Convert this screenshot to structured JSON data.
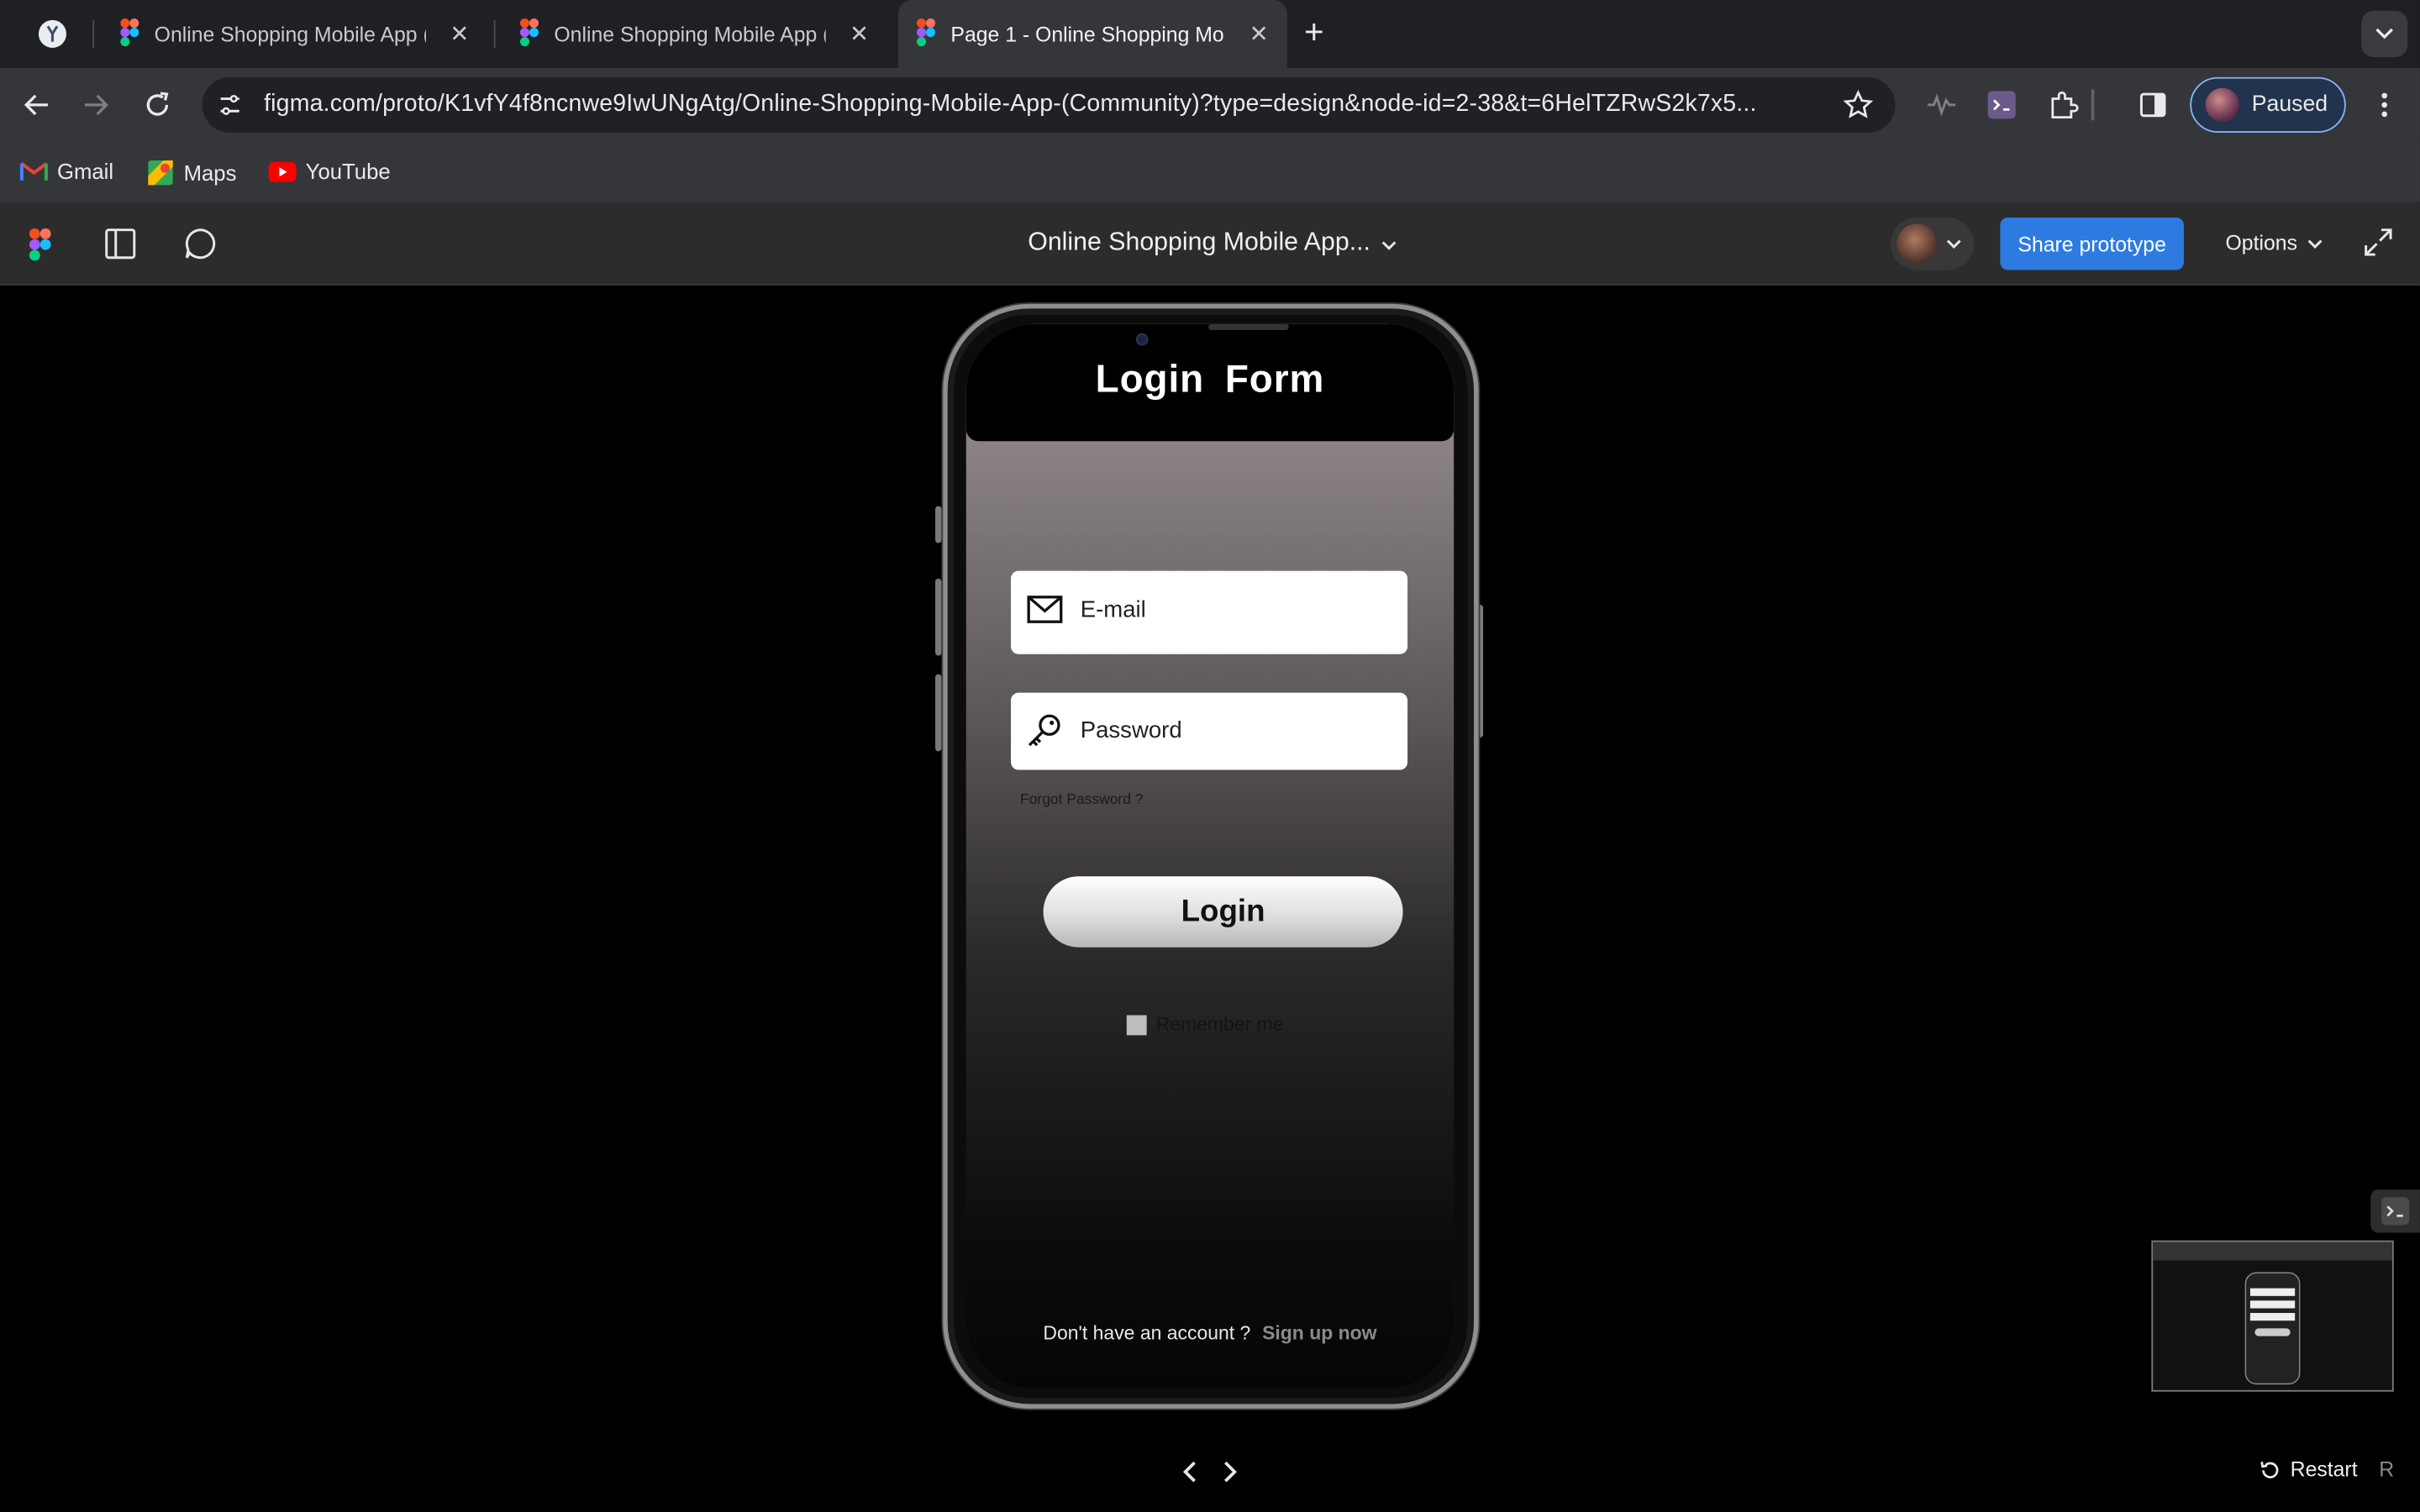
{
  "browser": {
    "tabs": [
      {
        "title": "Online Shopping Mobile App ("
      },
      {
        "title": "Online Shopping Mobile App ("
      },
      {
        "title": "Page 1 - Online Shopping Mo"
      }
    ],
    "url": "figma.com/proto/K1vfY4f8ncnwe9IwUNgAtg/Online-Shopping-Mobile-App-(Community)?type=design&node-id=2-38&t=6HelTZRwS2k7x5...",
    "profile_label": "Paused",
    "bookmarks": [
      {
        "label": "Gmail"
      },
      {
        "label": "Maps"
      },
      {
        "label": "YouTube"
      }
    ]
  },
  "figma": {
    "file_title": "Online Shopping Mobile App...",
    "share_label": "Share prototype",
    "options_label": "Options",
    "restart_label": "Restart",
    "restart_key": "R"
  },
  "login_screen": {
    "title": "Login  Form",
    "email_placeholder": "E-mail",
    "password_placeholder": "Password",
    "forgot_label": "Forgot Password ?",
    "login_button": "Login",
    "remember_label": "Remember me",
    "no_account_text": "Don't have an account ?",
    "signup_link": "Sign up now"
  },
  "colors": {
    "figma_blue": "#2d7be0",
    "browser_bg": "#35363a",
    "tab_strip": "#1f2023"
  }
}
